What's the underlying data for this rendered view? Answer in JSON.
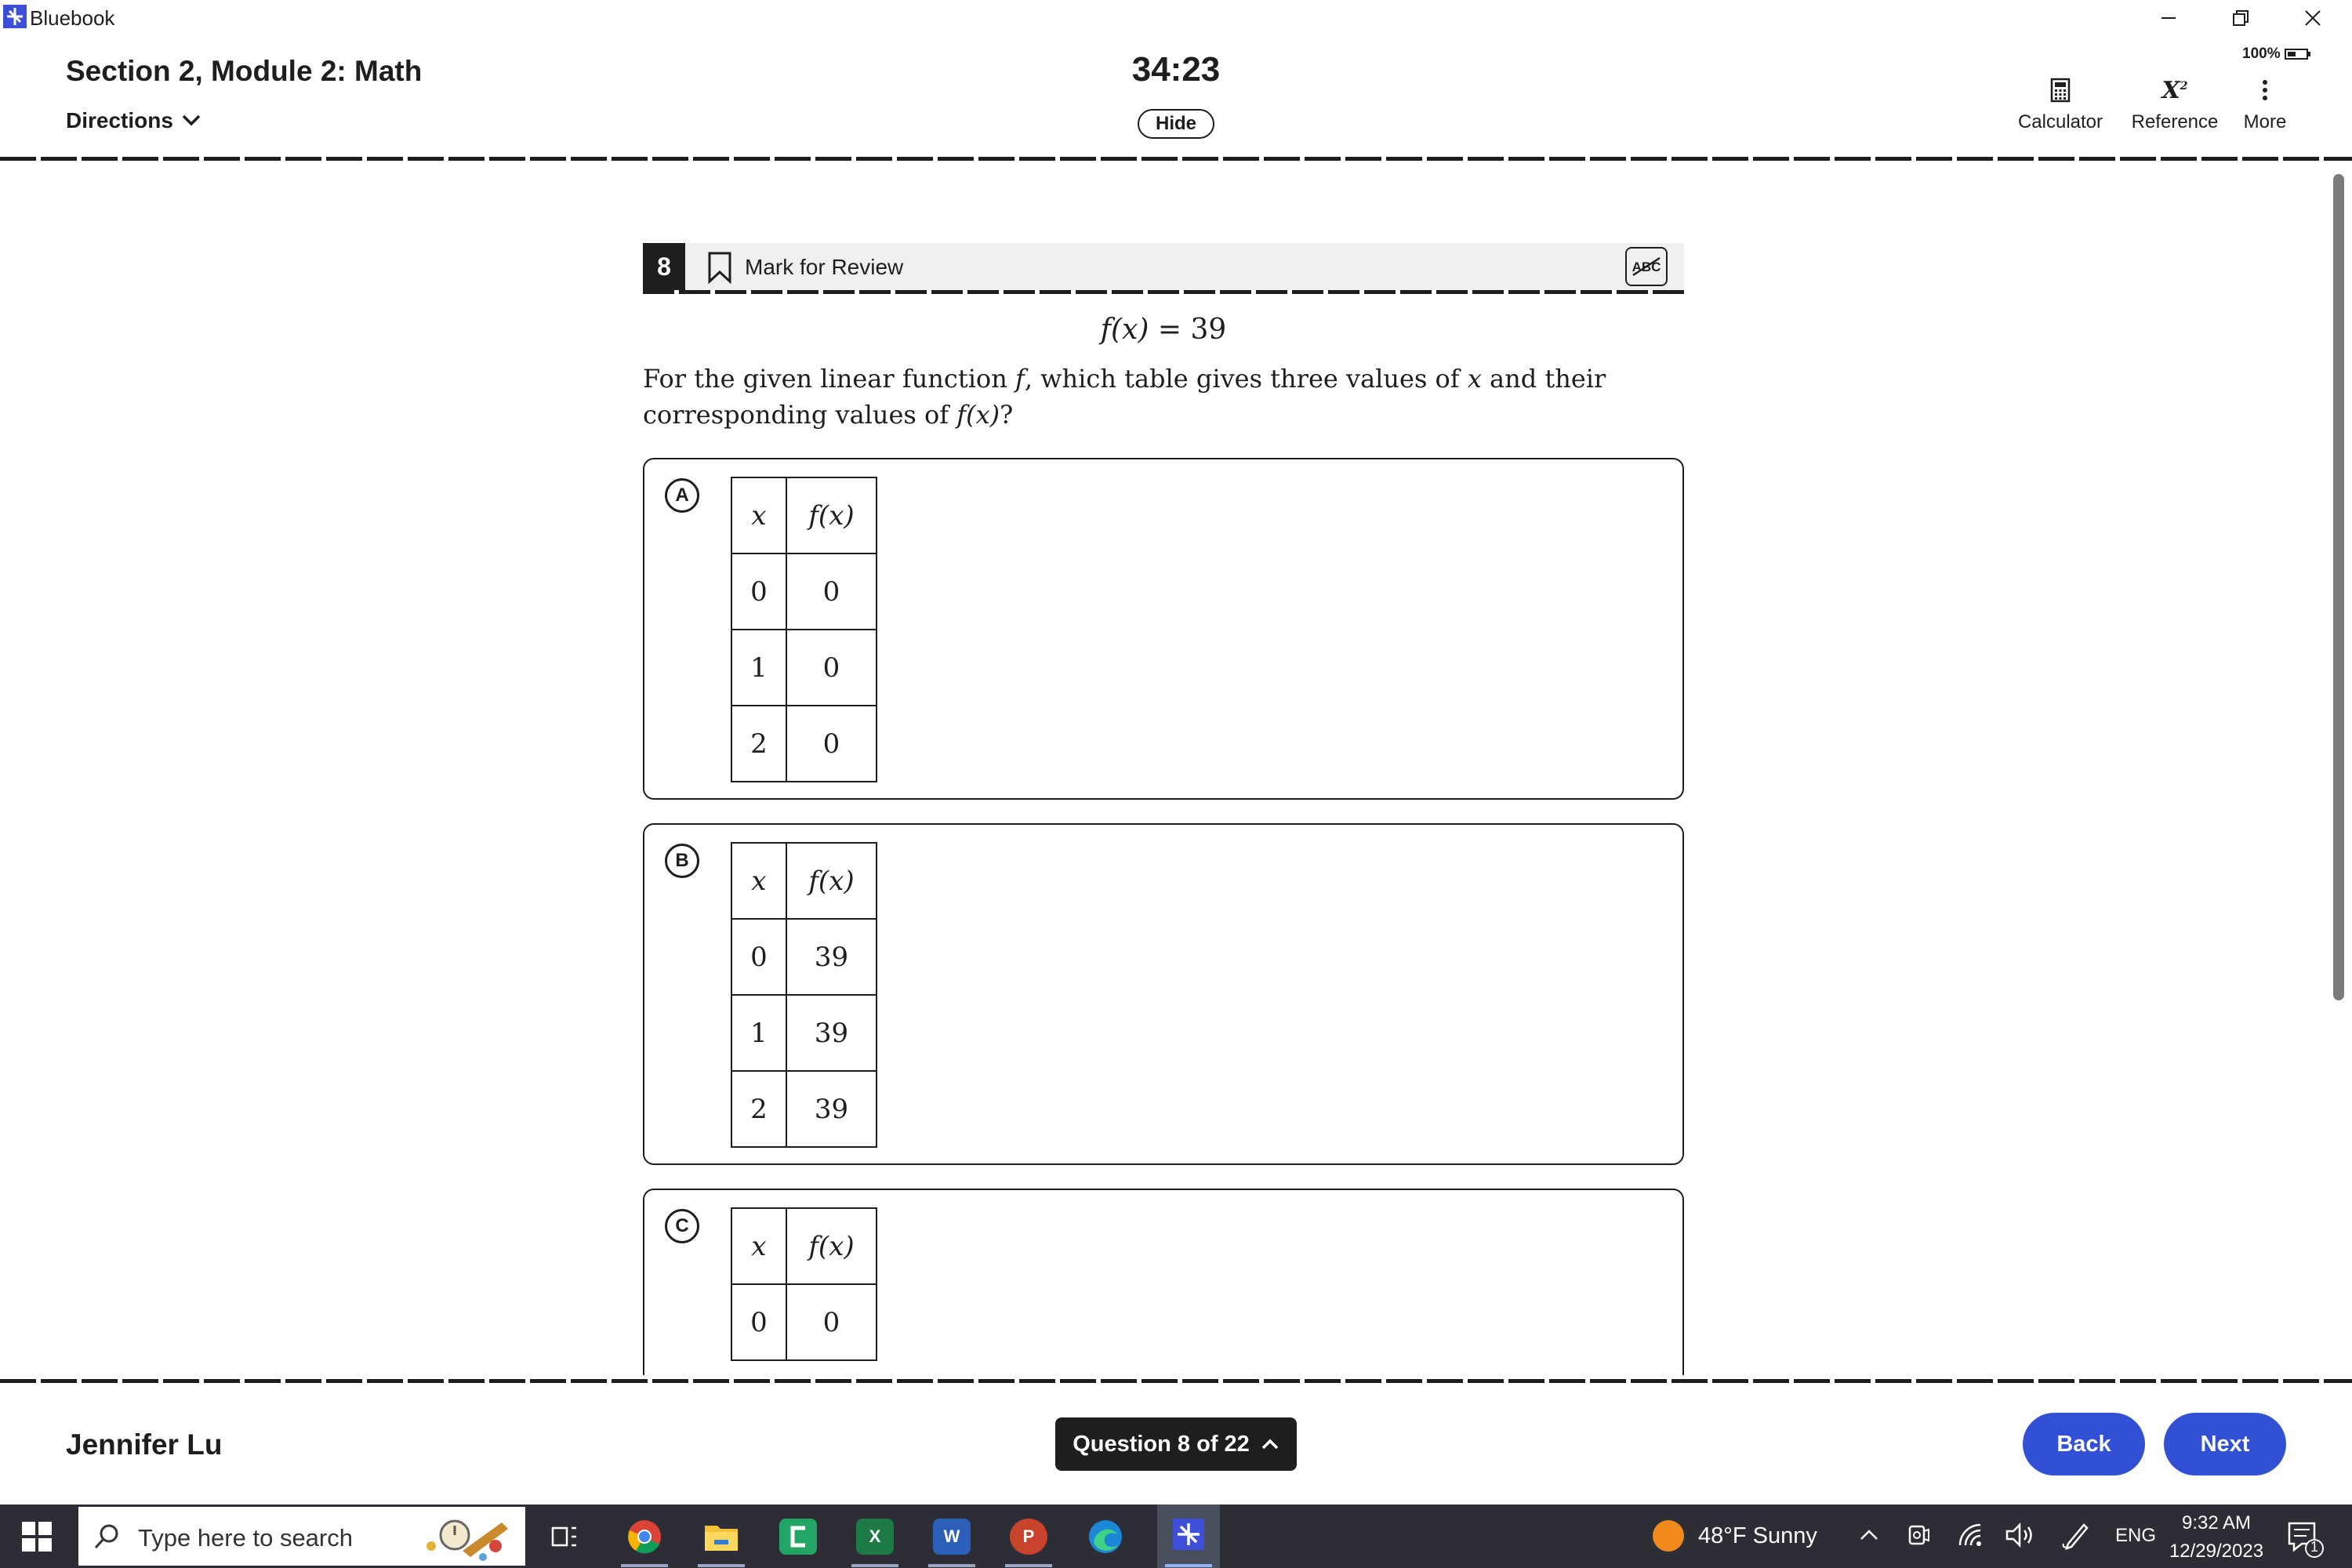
{
  "window": {
    "app_title": "Bluebook"
  },
  "header": {
    "section_title": "Section 2, Module 2: Math",
    "directions_label": "Directions",
    "timer": "34:23",
    "hide_label": "Hide",
    "zoom": "100%",
    "tools": {
      "calculator": "Calculator",
      "reference": "Reference",
      "more": "More"
    }
  },
  "question": {
    "number": "8",
    "mark_for_review": "Mark for Review",
    "abc_label": "ABC",
    "equation_lhs": "f(x)",
    "equation_rhs": "= 39",
    "text_a": "For the given linear function ",
    "f": "f",
    "text_b": ", which table gives three values of ",
    "x": "x",
    "text_c": " and their corresponding values of ",
    "fx": "f(x)",
    "text_d": "?",
    "col_x": "x",
    "col_fx": "f(x)",
    "choices": [
      {
        "letter": "A",
        "rows": [
          [
            "0",
            "0"
          ],
          [
            "1",
            "0"
          ],
          [
            "2",
            "0"
          ]
        ]
      },
      {
        "letter": "B",
        "rows": [
          [
            "0",
            "39"
          ],
          [
            "1",
            "39"
          ],
          [
            "2",
            "39"
          ]
        ]
      },
      {
        "letter": "C",
        "rows": [
          [
            "0",
            "0"
          ]
        ]
      }
    ]
  },
  "footer": {
    "student_name": "Jennifer Lu",
    "question_nav": "Question 8 of 22",
    "back_label": "Back",
    "next_label": "Next"
  },
  "taskbar": {
    "search_placeholder": "Type here to search",
    "weather": "48°F  Sunny",
    "language": "ENG",
    "time": "9:32 AM",
    "date": "12/29/2023",
    "notification_count": "1",
    "app_letters": {
      "excel": "X",
      "word": "W",
      "powerpoint": "P"
    }
  }
}
